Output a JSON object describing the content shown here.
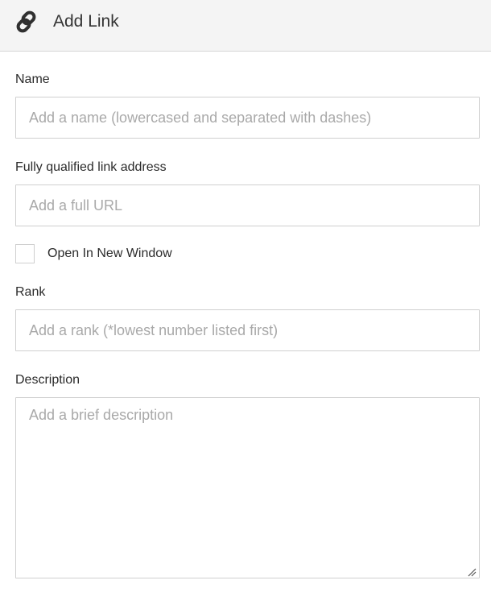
{
  "header": {
    "icon": "link-icon",
    "title": "Add Link"
  },
  "form": {
    "name": {
      "label": "Name",
      "value": "",
      "placeholder": "Add a name (lowercased and separated with dashes)"
    },
    "url": {
      "label": "Fully qualified link address",
      "value": "",
      "placeholder": "Add a full URL"
    },
    "new_window": {
      "label": "Open In New Window",
      "checked": false
    },
    "rank": {
      "label": "Rank",
      "value": "",
      "placeholder": "Add a rank (*lowest number listed first)"
    },
    "description": {
      "label": "Description",
      "value": "",
      "placeholder": "Add a brief description"
    }
  }
}
